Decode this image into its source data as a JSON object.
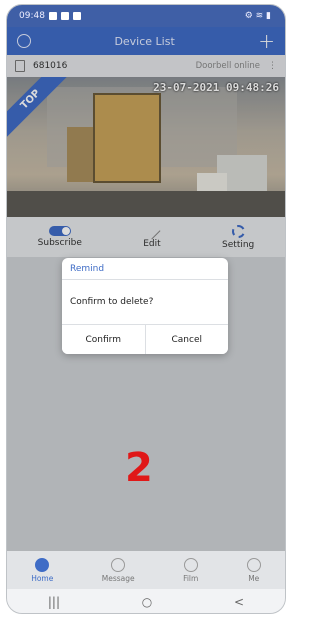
{
  "status": {
    "time": "09:48",
    "right_icons": "⚙ ≋ ▮"
  },
  "header": {
    "title": "Device List"
  },
  "device": {
    "name": "681016",
    "status": "Doorbell online"
  },
  "camera": {
    "timestamp": "23-07-2021 09:48:26",
    "badge": "TOP"
  },
  "actions": {
    "subscribe": "Subscribe",
    "edit": "Edit",
    "setting": "Setting"
  },
  "dialog": {
    "title": "Remind",
    "message": "Confirm to delete?",
    "confirm": "Confirm",
    "cancel": "Cancel"
  },
  "annotation": {
    "number": "2"
  },
  "tabs": [
    {
      "label": "Home"
    },
    {
      "label": "Message"
    },
    {
      "label": "Film"
    },
    {
      "label": "Me"
    }
  ],
  "navbar": {
    "recent": "|||",
    "home": "○",
    "back": "<"
  },
  "colors": {
    "accent": "#3f6cc6",
    "annotation": "#e01818"
  }
}
